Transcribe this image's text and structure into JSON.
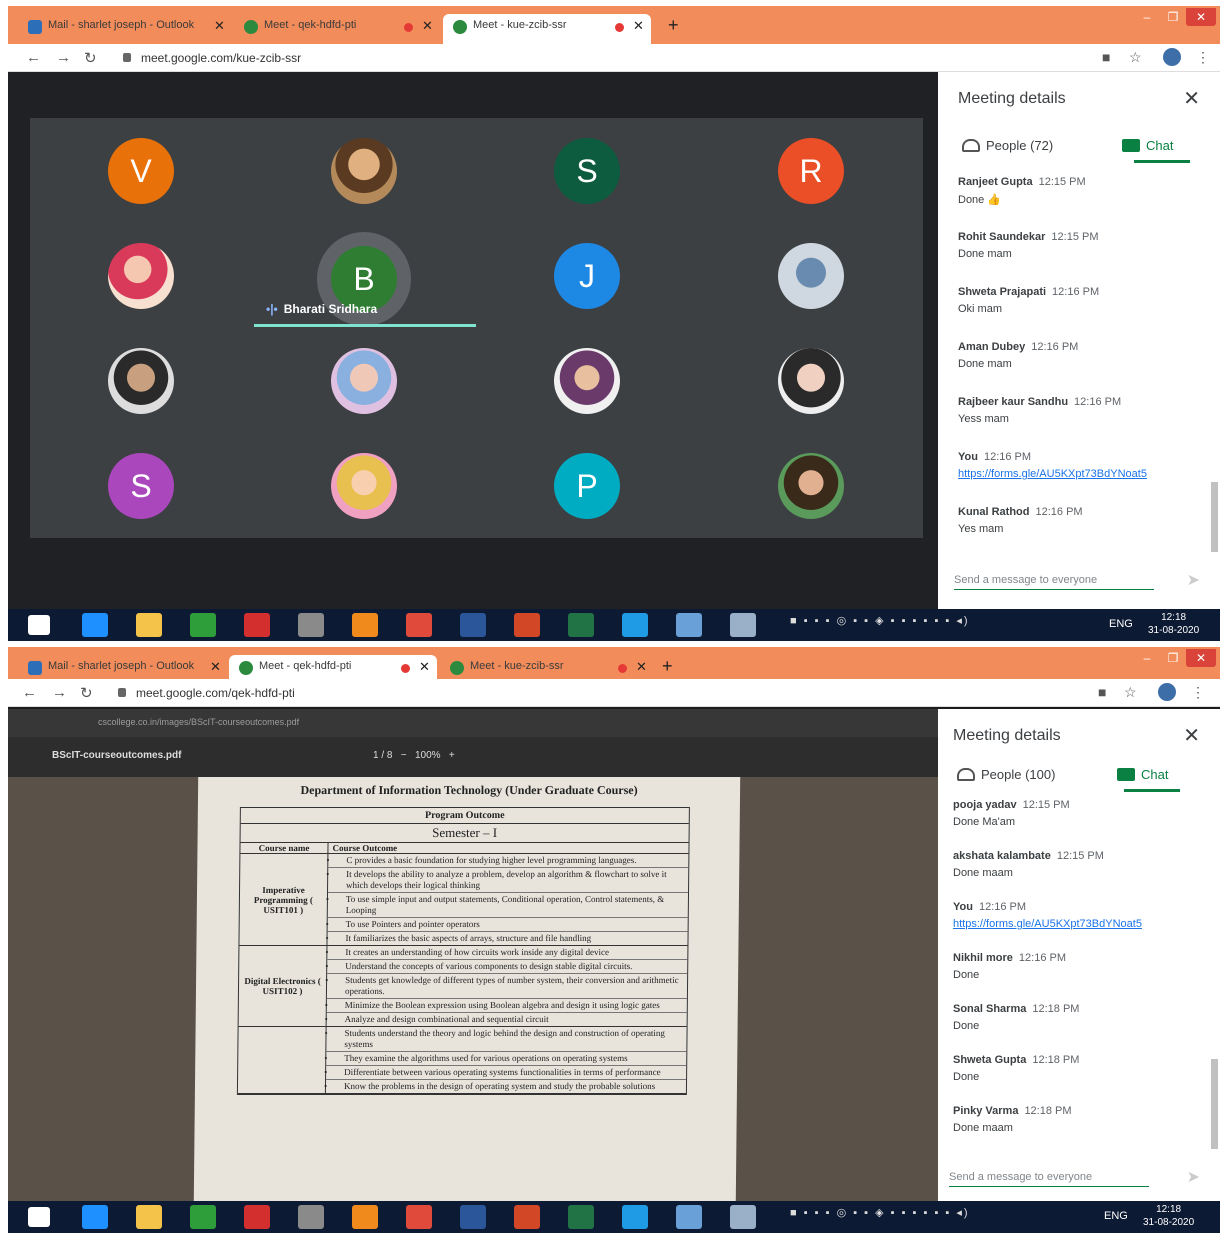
{
  "shot1": {
    "tabs": [
      {
        "label": "Mail - sharlet joseph - Outlook"
      },
      {
        "label": "Meet - qek-hdfd-pti"
      },
      {
        "label": "Meet - kue-zcib-ssr"
      }
    ],
    "url": "meet.google.com/kue-zcib-ssr",
    "participants": [
      {
        "initial": "V",
        "color": "#e8710a"
      },
      {
        "initial": "",
        "photo": "ph1"
      },
      {
        "initial": "S",
        "color": "#0d5c3f"
      },
      {
        "initial": "R",
        "color": "#ea4f27"
      },
      {
        "initial": "",
        "photo": "ph2"
      },
      {
        "initial": "",
        "photo": "ph3"
      },
      {
        "initial": "J",
        "color": "#1e88e5"
      },
      {
        "initial": "",
        "photo": "ph3"
      },
      {
        "initial": "",
        "photo": "ph4"
      },
      {
        "initial": "",
        "photo": "ph5"
      },
      {
        "initial": "",
        "photo": "ph6"
      },
      {
        "initial": "",
        "photo": "ph7"
      },
      {
        "initial": "S",
        "color": "#ab47bc"
      },
      {
        "initial": "",
        "photo": "ph8"
      },
      {
        "initial": "P",
        "color": "#00acc1"
      },
      {
        "initial": "",
        "photo": "ph9"
      }
    ],
    "speaker": {
      "initial": "B",
      "name": "Bharati Sridhara"
    },
    "panel": {
      "title": "Meeting details",
      "people_tab": "People (72)",
      "chat_tab": "Chat",
      "messages": [
        {
          "author": "Ranjeet Gupta",
          "time": "12:15 PM",
          "text": "Done 👍"
        },
        {
          "author": "Rohit Saundekar",
          "time": "12:15 PM",
          "text": "Done mam"
        },
        {
          "author": "Shweta Prajapati",
          "time": "12:16 PM",
          "text": "Oki mam"
        },
        {
          "author": "Aman Dubey",
          "time": "12:16 PM",
          "text": "Done mam"
        },
        {
          "author": "Rajbeer kaur Sandhu",
          "time": "12:16 PM",
          "text": "Yess mam"
        },
        {
          "author": "You",
          "time": "12:16 PM",
          "text": "https://forms.gle/AU5KXpt73BdYNoat5",
          "link": true
        },
        {
          "author": "Kunal Rathod",
          "time": "12:16 PM",
          "text": "Yes mam"
        }
      ],
      "send_placeholder": "Send a message to everyone"
    },
    "taskbar": {
      "lang": "ENG",
      "time": "12:18",
      "date": "31-08-2020"
    }
  },
  "shot2": {
    "tabs": [
      {
        "label": "Mail - sharlet joseph - Outlook"
      },
      {
        "label": "Meet - qek-hdfd-pti"
      },
      {
        "label": "Meet - kue-zcib-ssr"
      }
    ],
    "url": "meet.google.com/qek-hdfd-pti",
    "pdf": {
      "url": "cscollege.co.in/images/BScIT-courseoutcomes.pdf",
      "name": "BScIT-courseoutcomes.pdf",
      "page": "1 / 8",
      "zoom": "100%",
      "dept": "Department of Information Technology (Under Graduate Course)",
      "program_outcome": "Program Outcome",
      "semester": "Semester – I",
      "col_course": "Course name",
      "col_outcome": "Course Outcome",
      "courses": [
        {
          "name": "Imperative Programming ( USIT101 )",
          "outcomes": [
            "C provides a basic foundation for studying higher level programming languages.",
            "It develops the ability to analyze a problem, develop an algorithm & flowchart to solve it which develops their logical thinking",
            "To use simple input and output statements, Conditional operation, Control statements, & Looping",
            "To use Pointers and pointer operators",
            "It familiarizes the basic aspects of arrays, structure and file handling"
          ]
        },
        {
          "name": "Digital Electronics ( USIT102 )",
          "outcomes": [
            "It creates an understanding of how circuits work inside any digital device",
            "Understand the concepts of various components to design stable digital circuits.",
            "Students get knowledge of different types of number system, their conversion and arithmetic operations.",
            "Minimize the Boolean expression using Boolean algebra and design it using logic gates",
            "Analyze and design combinational and sequential circuit"
          ]
        },
        {
          "name": "",
          "outcomes": [
            "Students understand the theory and logic behind the design and construction of operating systems",
            "They examine the algorithms used for various operations on operating systems",
            "Differentiate between various operating systems functionalities in terms of performance",
            "Know the problems in the design of operating system and study the probable solutions"
          ]
        }
      ]
    },
    "panel": {
      "title": "Meeting details",
      "people_tab": "People (100)",
      "chat_tab": "Chat",
      "messages": [
        {
          "author": "pooja yadav",
          "time": "12:15 PM",
          "text": "Done Ma'am"
        },
        {
          "author": "akshata kalambate",
          "time": "12:15 PM",
          "text": "Done maam"
        },
        {
          "author": "You",
          "time": "12:16 PM",
          "text": "https://forms.gle/AU5KXpt73BdYNoat5",
          "link": true
        },
        {
          "author": "Nikhil more",
          "time": "12:16 PM",
          "text": "Done"
        },
        {
          "author": "Sonal Sharma",
          "time": "12:18 PM",
          "text": "Done"
        },
        {
          "author": "Shweta Gupta",
          "time": "12:18 PM",
          "text": "Done"
        },
        {
          "author": "Pinky Varma",
          "time": "12:18 PM",
          "text": "Done maam"
        }
      ],
      "send_placeholder": "Send a message to everyone"
    },
    "taskbar": {
      "lang": "ENG",
      "time": "12:18",
      "date": "31-08-2020"
    }
  },
  "taskbar_apps": [
    {
      "name": "windows-start",
      "color": "#ffffff"
    },
    {
      "name": "internet-explorer",
      "color": "#1e90ff"
    },
    {
      "name": "file-explorer",
      "color": "#f3c34a"
    },
    {
      "name": "store",
      "color": "#2e9e3a"
    },
    {
      "name": "acrobat-reader",
      "color": "#d32f2f"
    },
    {
      "name": "misc-app",
      "color": "#8a8a8a"
    },
    {
      "name": "vlc",
      "color": "#f08a1c"
    },
    {
      "name": "chrome",
      "color": "#e04a3a"
    },
    {
      "name": "word",
      "color": "#2b579a"
    },
    {
      "name": "powerpoint",
      "color": "#d24726"
    },
    {
      "name": "excel",
      "color": "#217346"
    },
    {
      "name": "edge",
      "color": "#1f9be5"
    },
    {
      "name": "misc-app-2",
      "color": "#6aa0d8"
    },
    {
      "name": "misc-app-3",
      "color": "#9ab0c8"
    }
  ]
}
